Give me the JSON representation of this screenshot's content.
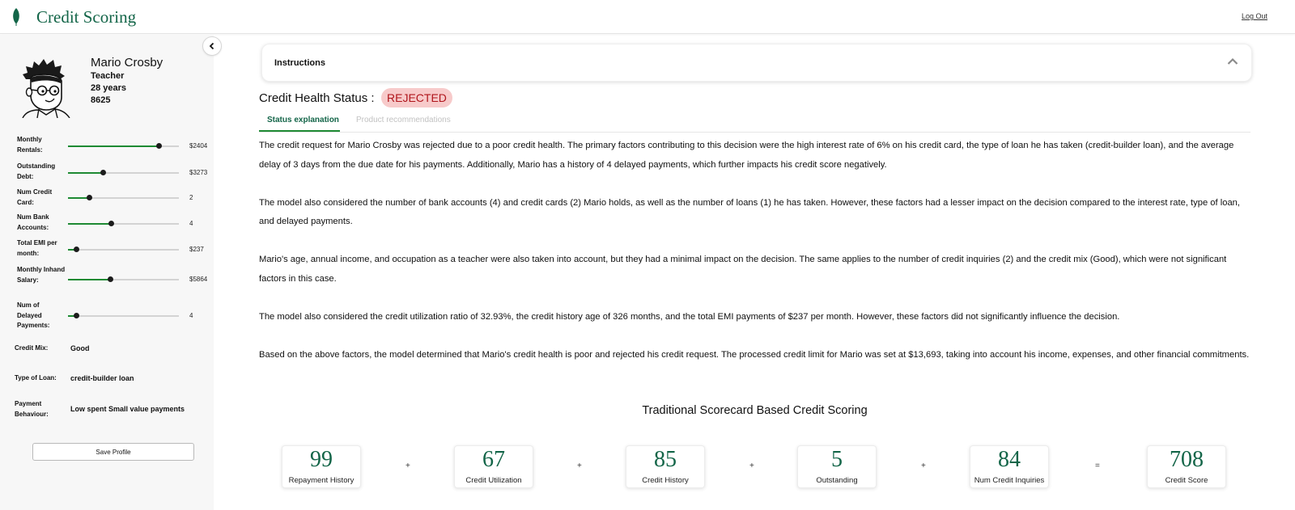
{
  "header": {
    "app_title": "Credit Scoring",
    "logout_label": "Log Out"
  },
  "colors": {
    "brand": "#136548",
    "accent_green": "#1e8a33",
    "rejected_bg": "#f7caca",
    "rejected_text": "#b0151c",
    "sidebar_bg": "#f7f7f7"
  },
  "profile": {
    "name": "Mario Crosby",
    "occupation": "Teacher",
    "age": "28 years",
    "id": "8625"
  },
  "sliders": [
    {
      "label": "Monthly Rentals:",
      "value": "$2404",
      "level": 0.82
    },
    {
      "label": "Outstanding Debt:",
      "value": "$3273",
      "level": 0.32
    },
    {
      "label": "Num Credit Card:",
      "value": "2",
      "level": 0.19
    },
    {
      "label": "Num Bank Accounts:",
      "value": "4",
      "level": 0.39
    },
    {
      "label": "Total EMI per month:",
      "value": "$237",
      "level": 0.08
    },
    {
      "label": "Monthly Inhand Salary:",
      "value": "$5864",
      "level": 0.38
    },
    {
      "label": "Num of Delayed Payments:",
      "value": "4",
      "level": 0.08
    }
  ],
  "profile_info": {
    "credit_mix_label": "Credit Mix:",
    "credit_mix_value": "Good",
    "loan_type_label": "Type of Loan:",
    "loan_type_value": "credit-builder loan",
    "payment_label": "Payment Behaviour:",
    "payment_value": "Low spent Small value payments"
  },
  "save_label": "Save Profile",
  "instructions": {
    "title": "Instructions"
  },
  "status": {
    "title": "Credit Health Status :",
    "badge": "REJECTED"
  },
  "tabs": [
    {
      "label": "Status explanation"
    },
    {
      "label": "Product recommendations"
    }
  ],
  "explanation": [
    "The credit request for Mario Crosby was rejected due to a poor credit health. The primary factors contributing to this decision were the high interest rate of 6% on his credit card, the type of loan he has taken (credit-builder loan), and the average delay of 3 days from the due date for his payments. Additionally, Mario has a history of 4 delayed payments, which further impacts his credit score negatively.",
    "The model also considered the number of bank accounts (4) and credit cards (2) Mario holds, as well as the number of loans (1) he has taken. However, these factors had a lesser impact on the decision compared to the interest rate, type of loan, and delayed payments.",
    "Mario's age, annual income, and occupation as a teacher were also taken into account, but they had a minimal impact on the decision. The same applies to the number of credit inquiries (2) and the credit mix (Good), which were not significant factors in this case.",
    "The model also considered the credit utilization ratio of 32.93%, the credit history age of 326 months, and the total EMI payments of $237 per month. However, these factors did not significantly influence the decision.",
    "Based on the above factors, the model determined that Mario's credit health is poor and rejected his credit request. The processed credit limit for Mario was set at $13,693, taking into account his income, expenses, and other financial commitments."
  ],
  "scorecard": {
    "title": "Traditional Scorecard Based Credit Scoring",
    "items": [
      {
        "value": "99",
        "label": "Repayment History"
      },
      {
        "value": "67",
        "label": "Credit Utilization"
      },
      {
        "value": "85",
        "label": "Credit History"
      },
      {
        "value": "5",
        "label": "Outstanding"
      },
      {
        "value": "84",
        "label": "Num Credit Inquiries"
      }
    ],
    "plus": "+",
    "equals": "=",
    "total": {
      "value": "708",
      "label": "Credit Score"
    }
  },
  "icons": {
    "logo": "leaf-logo-icon",
    "collapse": "chevron-left-icon",
    "instructions_toggle": "chevron-up-icon"
  }
}
